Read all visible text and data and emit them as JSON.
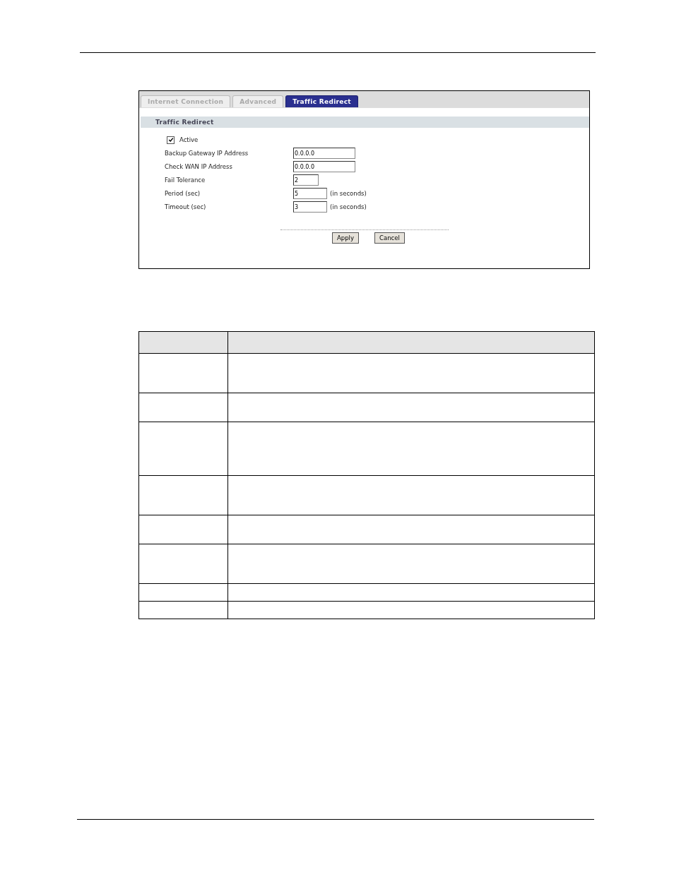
{
  "tabs": [
    {
      "label": "Internet Connection",
      "selected": false
    },
    {
      "label": "Advanced",
      "selected": false
    },
    {
      "label": "Traffic Redirect",
      "selected": true
    }
  ],
  "section_title": "Traffic Redirect",
  "active": {
    "label": "Active",
    "checked": true
  },
  "fields": [
    {
      "label": "Backup Gateway IP Address",
      "value": "0.0.0.0",
      "kind": "long"
    },
    {
      "label": "Check WAN IP Address",
      "value": "0.0.0.0",
      "kind": "long"
    },
    {
      "label": "Fail Tolerance",
      "value": "2",
      "kind": "short"
    },
    {
      "label": "Period (sec)",
      "value": "5",
      "kind": "medium",
      "unit": "(in seconds)"
    },
    {
      "label": "Timeout (sec)",
      "value": "3",
      "kind": "medium",
      "unit": "(in seconds)"
    }
  ],
  "buttons": [
    "Apply",
    "Cancel"
  ]
}
